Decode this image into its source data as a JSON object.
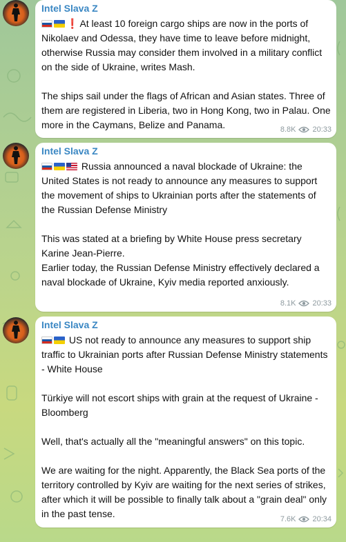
{
  "channel": "Intel Slava Z",
  "messages": [
    {
      "sender": "Intel Slava Z",
      "flags": [
        "ru",
        "ua",
        "exclamation"
      ],
      "text": "At least 10 foreign cargo ships are now in the ports of Nikolaev and Odessa, they have time to leave before midnight, otherwise Russia may consider them involved in a military conflict on the side of Ukraine, writes Mash.\n\nThe ships sail under the flags of African and Asian states. Three of them are registered in Liberia, two in Hong Kong, two in Palau. One more in the Caymans, Belize and Panama.",
      "views": "8.8K",
      "time": "20:33"
    },
    {
      "sender": "Intel Slava Z",
      "flags": [
        "ru",
        "ua",
        "us"
      ],
      "text": "Russia announced a naval blockade of Ukraine: the United States is not ready to announce any measures to support the movement of ships to Ukrainian ports after the statements of the Russian Defense Ministry\n\nThis was stated at a briefing by White House press secretary Karine Jean-Pierre.\nEarlier today, the Russian Defense Ministry effectively declared a naval blockade of Ukraine, Kyiv media reported anxiously.",
      "views": "8.1K",
      "time": "20:33"
    },
    {
      "sender": "Intel Slava Z",
      "flags": [
        "ru",
        "ua"
      ],
      "text": "US not ready to announce any measures to support ship traffic to Ukrainian ports after Russian Defense Ministry statements - White House\n\nTürkiye will not escort ships with grain at the request of Ukraine - Bloomberg\n\nWell, that's actually all the \"meaningful answers\" on this topic.\n\nWe are waiting for the night. Apparently, the Black Sea ports of the territory controlled by Kyiv are waiting for the next series of strikes, after which it will be possible to finally talk about a \"grain deal\" only in the past tense.",
      "views": "7.6K",
      "time": "20:34"
    }
  ],
  "icons": {
    "views": "eye-icon",
    "avatar": "channel-avatar"
  },
  "colors": {
    "sender": "#3a87c3",
    "meta": "#8e9a9f",
    "bubble": "#ffffff"
  }
}
